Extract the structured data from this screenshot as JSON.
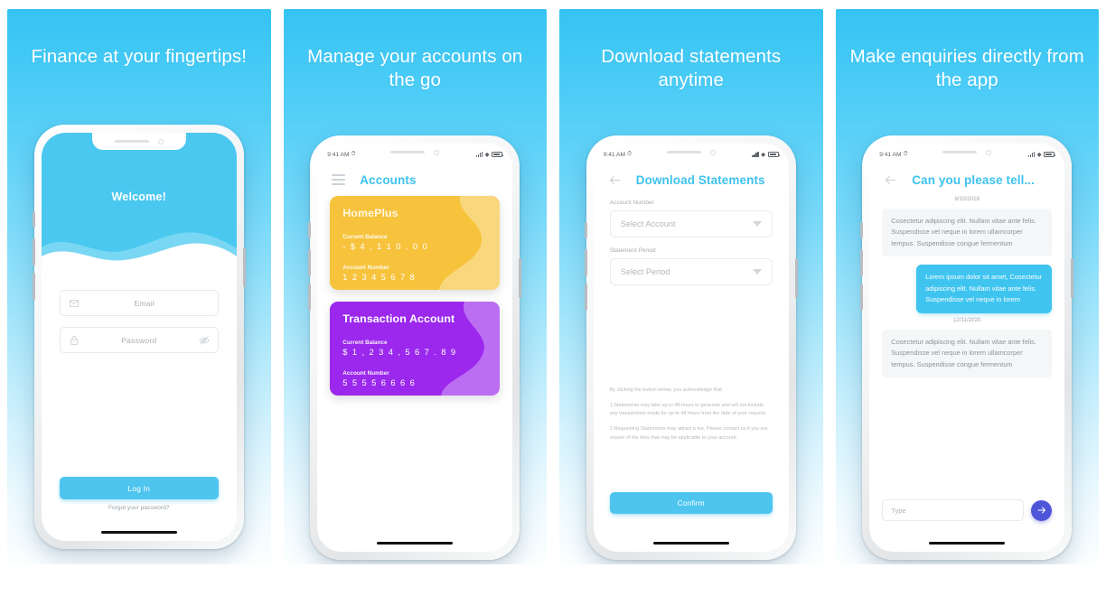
{
  "panels": [
    {
      "headline": "Finance at your fingertips!"
    },
    {
      "headline": "Manage your accounts on the go"
    },
    {
      "headline": "Download statements anytime"
    },
    {
      "headline": "Make enquiries directly from the app"
    }
  ],
  "status_bar": {
    "time": "9:41 AM"
  },
  "login": {
    "welcome": "Welcome!",
    "email_placeholder": "Email",
    "password_placeholder": "Password",
    "login_label": "Log In",
    "forgot_label": "Forgot your password?"
  },
  "accounts": {
    "title": "Accounts",
    "cards": [
      {
        "name": "HomePlus",
        "balance_label": "Current Balance",
        "balance": "- $ 4 , 1 1 0 . 0 0",
        "number_label": "Account Number",
        "number": "1 2 3 4 5 6 7 8",
        "color": "#f7c33c"
      },
      {
        "name": "Transaction Account",
        "balance_label": "Current Balance",
        "balance": "$ 1 , 2 3 4 , 5 6 7 . 8 9",
        "number_label": "Account Number",
        "number": "5 5 5 5 6 6 6 6",
        "color": "#9b28ec"
      }
    ]
  },
  "statements": {
    "title": "Download Statements",
    "account_label": "Account Number",
    "account_value": "Select Account",
    "period_label": "Statement Period",
    "period_value": "Select Period",
    "disclaimer_intro": "By clicking the button below, you acknowledge that:",
    "disclaimer_1": "1.Statements may take up to 48 hours to generate and will not include any transactions made for up to 48 hours from the date of your request.",
    "disclaimer_2": "2.Requesting Statements may attract a fee. Please contact us if you are unsure of the fees that may be applicable to your account.",
    "confirm_label": "Confirm"
  },
  "chat": {
    "title": "Can you please tell...",
    "date_1": "8/10/2018",
    "msg_1": "Cosectetur adipiscing elit. Nullam vitae ante felis. Suspendisse vel neque in lorem ullamcorper tempus. Suspendisse congue fermentum",
    "msg_2": "Lorem ipsum dolor sit amet, Cosectetur adipiscing elit. Nullam vitae ante felis. Suspendisse vel neque in lorem",
    "date_2": "12/11/2020",
    "msg_3": "Cosectetur adipiscing elit. Nullam vitae ante felis. Suspendisse vel neque in lorem ullamcorper tempus. Suspendisse congue fermentum",
    "input_placeholder": "Type"
  },
  "colors": {
    "accent_blue": "#4ec5ef",
    "headline_blue": "#3ec2ee",
    "card_yellow": "#f7c33c",
    "card_purple": "#9b28ec",
    "send_purple": "#4f55d8",
    "bg_top": "#35c3f3"
  }
}
